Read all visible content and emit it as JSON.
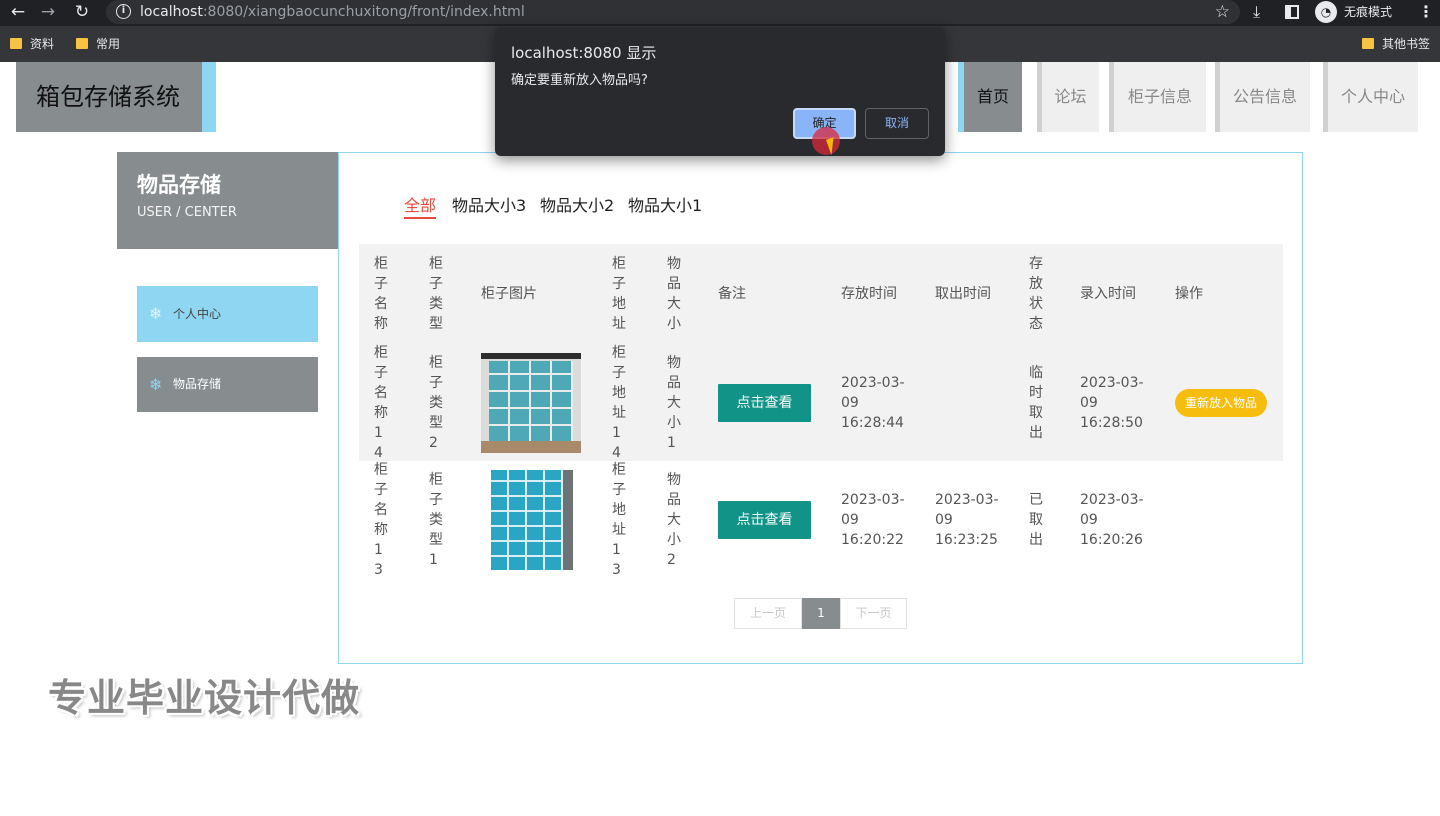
{
  "browser": {
    "url_host": "localhost",
    "url_rest": ":8080/xiangbaocunchuxitong/front/index.html",
    "incognito_label": "无痕模式",
    "bookmarks": [
      "资料",
      "常用",
      "其他书签"
    ]
  },
  "header": {
    "logo": "箱包存储系统",
    "nav": [
      "首页",
      "论坛",
      "柜子信息",
      "公告信息",
      "个人中心"
    ],
    "active_nav": "首页"
  },
  "sidebar": {
    "title": "物品存储",
    "subtitle": "USER / CENTER",
    "items": [
      {
        "label": "个人中心",
        "icon": "snowflake-icon"
      },
      {
        "label": "物品存储",
        "icon": "snowflake-icon"
      }
    ]
  },
  "filters": [
    "全部",
    "物品大小3",
    "物品大小2",
    "物品大小1"
  ],
  "table": {
    "headers": [
      "柜子名称",
      "柜子类型",
      "柜子图片",
      "柜子地址",
      "物品大小",
      "备注",
      "存放时间",
      "取出时间",
      "存放状态",
      "录入时间",
      "操作"
    ],
    "rows": [
      {
        "name": "柜子名称14",
        "type": "柜子类型2",
        "address": "柜子地址14",
        "size": "物品大小1",
        "note_button": "点击查看",
        "store_time": "2023-03-09 16:28:44",
        "take_time": "",
        "status": "临时取出",
        "entry_time": "2023-03-09 16:28:50",
        "action": "重新放入物品"
      },
      {
        "name": "柜子名称13",
        "type": "柜子类型1",
        "address": "柜子地址13",
        "size": "物品大小2",
        "note_button": "点击查看",
        "store_time": "2023-03-09 16:20:22",
        "take_time": "2023-03-09 16:23:25",
        "status": "已取出",
        "entry_time": "2023-03-09 16:20:26",
        "action": ""
      }
    ]
  },
  "pagination": {
    "prev": "上一页",
    "current": "1",
    "next": "下一页"
  },
  "watermark": "专业毕业设计代做",
  "dialog": {
    "title": "localhost:8080 显示",
    "message": "确定要重新放入物品吗?",
    "ok": "确定",
    "cancel": "取消"
  },
  "colors": {
    "accent_blue": "#8fd6f3",
    "gray": "#878c8f",
    "teal_button": "#119487",
    "yellow_button": "#f6bd0f",
    "filter_active": "#e84c3d"
  }
}
